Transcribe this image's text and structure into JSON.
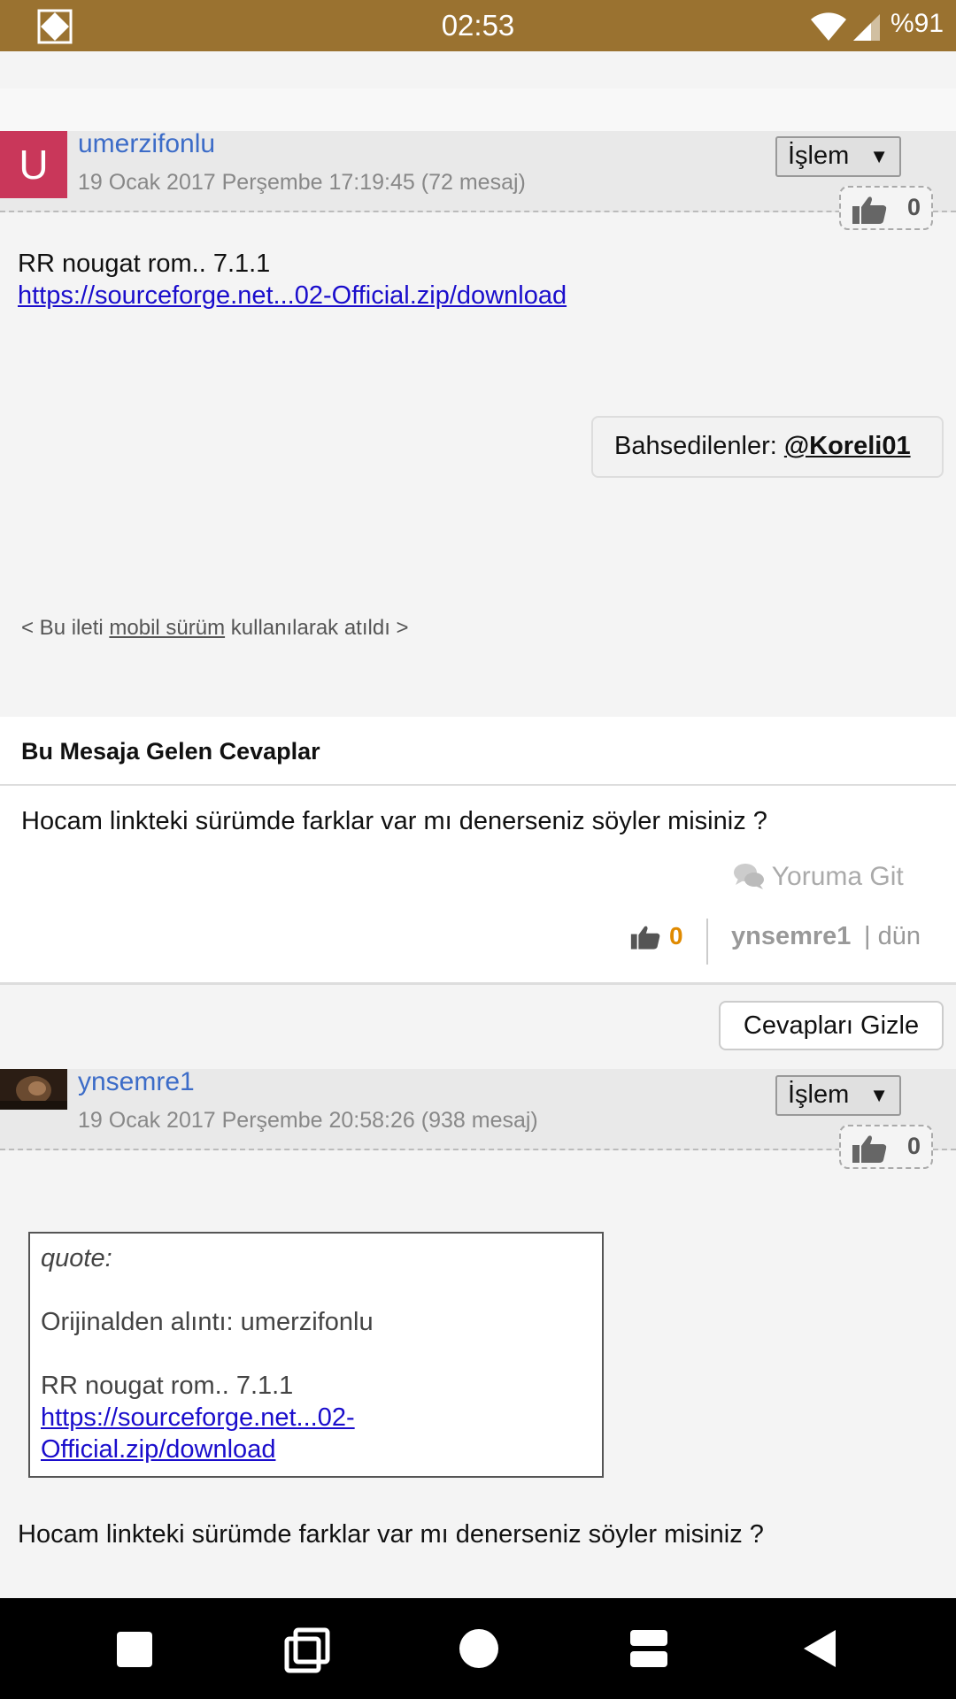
{
  "status_bar": {
    "time": "02:53",
    "battery": "%91"
  },
  "posts": [
    {
      "avatar_letter": "U",
      "username": "umerzifonlu",
      "date": "19 Ocak 2017 Perşembe 17:19:45 (72 mesaj)",
      "action_label": "İşlem",
      "likes": "0",
      "body_text": "RR nougat rom.. 7.1.1",
      "link_text": "https://sourceforge.net...02-Official.zip/download",
      "mentions_label": "Bahsedilenler:",
      "mentioned_user": "@Koreli01",
      "mobile_note_pre": "< Bu ileti",
      "mobile_note_link": "mobil sürüm",
      "mobile_note_post": "kullanılarak atıldı >"
    },
    {
      "username": "ynsemre1",
      "date": "19 Ocak 2017 Perşembe 20:58:26 (938 mesaj)",
      "action_label": "İşlem",
      "likes": "0",
      "quote": {
        "header": "quote:",
        "origin": "Orijinalden alıntı: umerzifonlu",
        "text": "RR nougat rom.. 7.1.1",
        "link_line1": "https://sourceforge.net...02-",
        "link_line2": "Official.zip/download"
      },
      "body_text": "Hocam linkteki sürümde farklar var mı denerseniz söyler misiniz ?"
    }
  ],
  "replies": {
    "title": "Bu Mesaja Gelen Cevaplar",
    "items": [
      {
        "text": "Hocam linkteki sürümde farklar var mı denerseniz söyler misiniz ?",
        "goto_label": "Yoruma Git",
        "likes": "0",
        "user": "ynsemre1",
        "when": "| dün"
      }
    ],
    "hide_label": "Cevapları Gizle"
  }
}
